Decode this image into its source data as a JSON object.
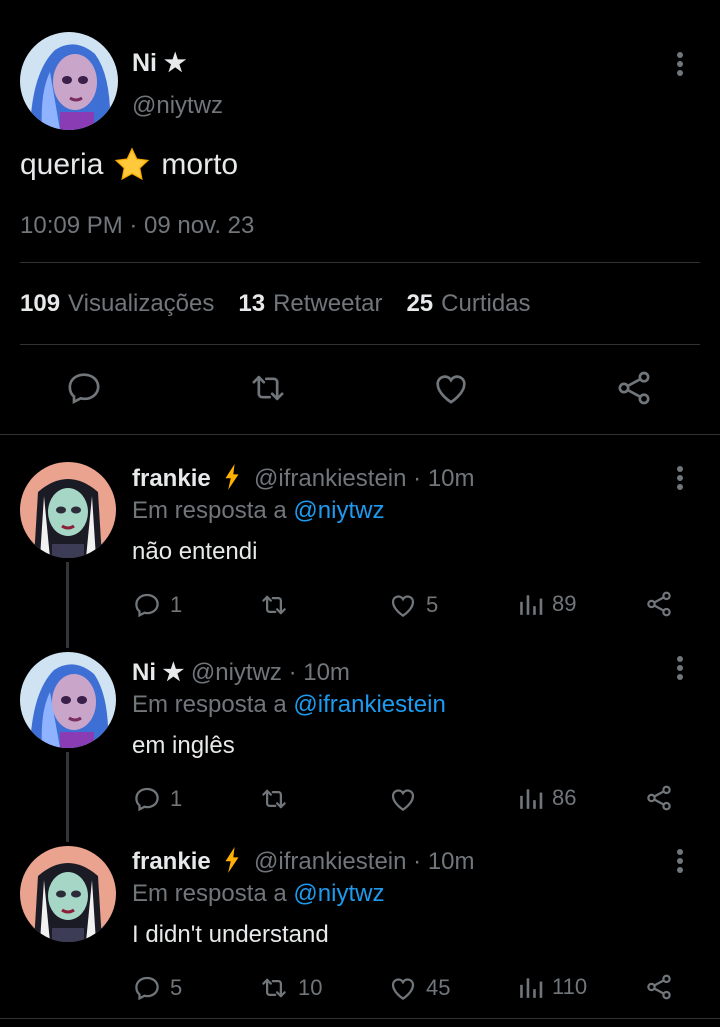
{
  "main_tweet": {
    "author_name": "Ni ★",
    "author_handle": "@niytwz",
    "text_before": "queria",
    "text_emoji": "star-emoji",
    "text_after": "morto",
    "timestamp": "10:09 PM · 09 nov. 23",
    "stats": {
      "views_count": "109",
      "views_label": "Visualizações",
      "retweets_count": "13",
      "retweets_label": "Retweetar",
      "likes_count": "25",
      "likes_label": "Curtidas"
    }
  },
  "replies": [
    {
      "name": "frankie",
      "badge": "lightning-icon",
      "handle": "@ifrankiestein",
      "time": "· 10m",
      "reply_prefix": "Em resposta a",
      "reply_to": "@niytwz",
      "text": "não entendi",
      "replies": "1",
      "retweets": "",
      "likes": "5",
      "views": "89"
    },
    {
      "name": "Ni ★",
      "badge": "",
      "handle": "@niytwz",
      "time": "· 10m",
      "reply_prefix": "Em resposta a",
      "reply_to": "@ifrankiestein",
      "text": "em inglês",
      "replies": "1",
      "retweets": "",
      "likes": "",
      "views": "86"
    },
    {
      "name": "frankie",
      "badge": "lightning-icon",
      "handle": "@ifrankiestein",
      "time": "· 10m",
      "reply_prefix": "Em resposta a",
      "reply_to": "@niytwz",
      "text": "I didn't understand",
      "replies": "5",
      "retweets": "10",
      "likes": "45",
      "views": "110"
    }
  ],
  "colors": {
    "background": "#000000",
    "text": "#e7e9ea",
    "muted": "#71767b",
    "link": "#1d9bf0",
    "lightning": "#ffb000"
  }
}
